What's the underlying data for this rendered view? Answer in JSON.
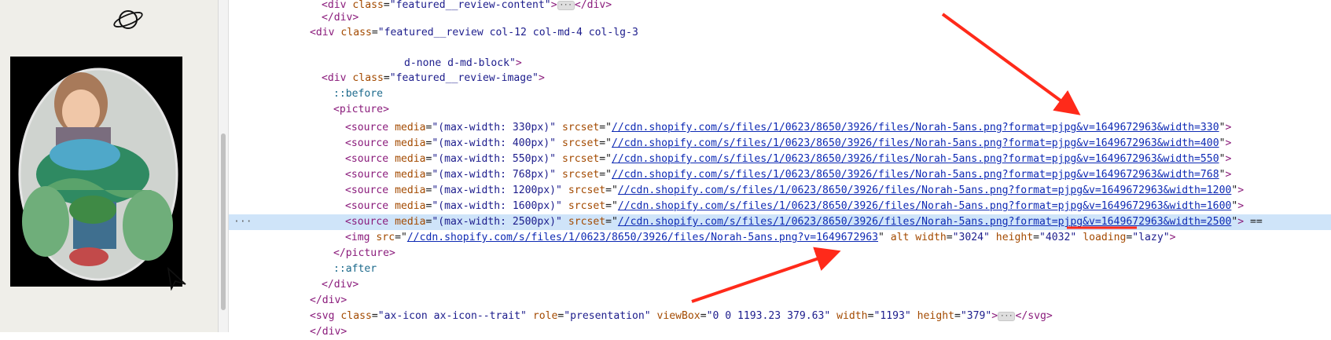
{
  "sidebar": {
    "planet_icon": "planet-icon",
    "photo_alt": "child holding chameleon artwork"
  },
  "gutter": {
    "selected_marker": "···",
    "selected_suffix": " =="
  },
  "lines": [
    {
      "indent": 1,
      "tri": "▶",
      "text_parts": [
        [
          "tag",
          "<div "
        ],
        [
          "attr",
          "class"
        ],
        [
          "",
          "="
        ],
        [
          "val",
          "\"featured__review-content\""
        ],
        [
          "tag",
          ">"
        ]
      ],
      "dots": true,
      "after": [
        [
          "tag",
          "</div>"
        ]
      ]
    },
    {
      "indent": 1,
      "tri": "",
      "text_parts": [
        [
          "tag",
          "</div>"
        ]
      ]
    },
    {
      "indent": 0,
      "tri": "▼",
      "text_parts": [
        [
          "tag",
          "<div "
        ],
        [
          "attr",
          "class"
        ],
        [
          "",
          "="
        ],
        [
          "val",
          "\"featured__review col-12 col-md-4 col-lg-3"
        ]
      ]
    },
    {
      "indent": 0,
      "tri": "",
      "text_parts": [
        [
          "",
          ""
        ]
      ]
    },
    {
      "indent": 8,
      "tri": "",
      "text_parts": [
        [
          "val",
          "d-none d-md-block\""
        ],
        [
          "tag",
          ">"
        ]
      ]
    },
    {
      "indent": 1,
      "tri": "▼",
      "text_parts": [
        [
          "tag",
          "<div "
        ],
        [
          "attr",
          "class"
        ],
        [
          "",
          "="
        ],
        [
          "val",
          "\"featured__review-image\""
        ],
        [
          "tag",
          ">"
        ]
      ]
    },
    {
      "indent": 2,
      "tri": "",
      "text_parts": [
        [
          "pseudo",
          "::before"
        ]
      ]
    },
    {
      "indent": 2,
      "tri": "▼",
      "text_parts": [
        [
          "tag",
          "<picture>"
        ]
      ]
    },
    {
      "indent": 3,
      "tri": "",
      "text_parts": [
        [
          "tag",
          "<source "
        ],
        [
          "attr",
          "media"
        ],
        [
          "",
          "="
        ],
        [
          "val",
          "\"(max-width: 330px)\""
        ],
        [
          "attr",
          " srcset"
        ],
        [
          "",
          "=\""
        ],
        [
          "url",
          "//cdn.shopify.com/s/files/1/0623/8650/3926/files/Norah-5ans.png?format=pjpg&v=1649672963&width=330"
        ],
        [
          "",
          "\""
        ],
        [
          "tag",
          ">"
        ]
      ]
    },
    {
      "indent": 3,
      "tri": "",
      "text_parts": [
        [
          "tag",
          "<source "
        ],
        [
          "attr",
          "media"
        ],
        [
          "",
          "="
        ],
        [
          "val",
          "\"(max-width: 400px)\""
        ],
        [
          "attr",
          " srcset"
        ],
        [
          "",
          "=\""
        ],
        [
          "url",
          "//cdn.shopify.com/s/files/1/0623/8650/3926/files/Norah-5ans.png?format=pjpg&v=1649672963&width=400"
        ],
        [
          "",
          "\""
        ],
        [
          "tag",
          ">"
        ]
      ]
    },
    {
      "indent": 3,
      "tri": "",
      "text_parts": [
        [
          "tag",
          "<source "
        ],
        [
          "attr",
          "media"
        ],
        [
          "",
          "="
        ],
        [
          "val",
          "\"(max-width: 550px)\""
        ],
        [
          "attr",
          " srcset"
        ],
        [
          "",
          "=\""
        ],
        [
          "url",
          "//cdn.shopify.com/s/files/1/0623/8650/3926/files/Norah-5ans.png?format=pjpg&v=1649672963&width=550"
        ],
        [
          "",
          "\""
        ],
        [
          "tag",
          ">"
        ]
      ]
    },
    {
      "indent": 3,
      "tri": "",
      "text_parts": [
        [
          "tag",
          "<source "
        ],
        [
          "attr",
          "media"
        ],
        [
          "",
          "="
        ],
        [
          "val",
          "\"(max-width: 768px)\""
        ],
        [
          "attr",
          " srcset"
        ],
        [
          "",
          "=\""
        ],
        [
          "url",
          "//cdn.shopify.com/s/files/1/0623/8650/3926/files/Norah-5ans.png?format=pjpg&v=1649672963&width=768"
        ],
        [
          "",
          "\""
        ],
        [
          "tag",
          ">"
        ]
      ]
    },
    {
      "indent": 3,
      "tri": "",
      "text_parts": [
        [
          "tag",
          "<source "
        ],
        [
          "attr",
          "media"
        ],
        [
          "",
          "="
        ],
        [
          "val",
          "\"(max-width: 1200px)\""
        ],
        [
          "attr",
          " srcset"
        ],
        [
          "",
          "=\""
        ],
        [
          "url",
          "//cdn.shopify.com/s/files/1/0623/8650/3926/files/Norah-5ans.png?format=pjpg&v=1649672963&width=1200"
        ],
        [
          "",
          "\""
        ],
        [
          "tag",
          ">"
        ]
      ]
    },
    {
      "indent": 3,
      "tri": "",
      "text_parts": [
        [
          "tag",
          "<source "
        ],
        [
          "attr",
          "media"
        ],
        [
          "",
          "="
        ],
        [
          "val",
          "\"(max-width: 1600px)\""
        ],
        [
          "attr",
          " srcset"
        ],
        [
          "",
          "=\""
        ],
        [
          "url",
          "//cdn.shopify.com/s/files/1/0623/8650/3926/files/Norah-5ans.png?format=pjpg&v=1649672963&width=1600"
        ],
        [
          "",
          "\""
        ],
        [
          "tag",
          ">"
        ]
      ]
    },
    {
      "indent": 3,
      "tri": "",
      "selected": true,
      "text_parts": [
        [
          "tag",
          "<source "
        ],
        [
          "attr",
          "media"
        ],
        [
          "",
          "="
        ],
        [
          "val",
          "\"(max-width: 2500px)\""
        ],
        [
          "attr",
          " srcset"
        ],
        [
          "",
          "=\""
        ],
        [
          "url",
          "//cdn.shopify.com/s/files/1/0623/8650/3926/files/Norah-5ans.png?format=pjpg&v=1649672963&width=2500"
        ],
        [
          "",
          "\""
        ],
        [
          "tag",
          ">"
        ]
      ]
    },
    {
      "indent": 3,
      "tri": "",
      "text_parts": [
        [
          "tag",
          "<img "
        ],
        [
          "attr",
          "src"
        ],
        [
          "",
          "=\""
        ],
        [
          "url",
          "//cdn.shopify.com/s/files/1/0623/8650/3926/files/Norah-5ans.png?v=1649672963"
        ],
        [
          "",
          "\""
        ],
        [
          "attr",
          " alt width"
        ],
        [
          "",
          "="
        ],
        [
          "val",
          "\"3024\""
        ],
        [
          "attr",
          " height"
        ],
        [
          "",
          "="
        ],
        [
          "val",
          "\"4032\""
        ],
        [
          "attr",
          " loading"
        ],
        [
          "",
          "="
        ],
        [
          "val",
          "\"lazy\""
        ],
        [
          "tag",
          ">"
        ]
      ]
    },
    {
      "indent": 2,
      "tri": "",
      "text_parts": [
        [
          "tag",
          "</picture>"
        ]
      ]
    },
    {
      "indent": 2,
      "tri": "",
      "text_parts": [
        [
          "pseudo",
          "::after"
        ]
      ]
    },
    {
      "indent": 1,
      "tri": "",
      "text_parts": [
        [
          "tag",
          "</div>"
        ]
      ]
    },
    {
      "indent": 0,
      "tri": "",
      "text_parts": [
        [
          "tag",
          "</div>"
        ]
      ]
    },
    {
      "indent": 0,
      "tri": "▶",
      "text_parts": [
        [
          "tag",
          "<svg "
        ],
        [
          "attr",
          "class"
        ],
        [
          "",
          "="
        ],
        [
          "val",
          "\"ax-icon ax-icon--trait\""
        ],
        [
          "attr",
          " role"
        ],
        [
          "",
          "="
        ],
        [
          "val",
          "\"presentation\""
        ],
        [
          "attr",
          " viewBox"
        ],
        [
          "",
          "="
        ],
        [
          "val",
          "\"0 0 1193.23 379.63\""
        ],
        [
          "attr",
          " width"
        ],
        [
          "",
          "="
        ],
        [
          "val",
          "\"1193\""
        ],
        [
          "attr",
          " height"
        ],
        [
          "",
          "="
        ],
        [
          "val",
          "\"379\""
        ],
        [
          "tag",
          ">"
        ]
      ],
      "dots": true,
      "after": [
        [
          "tag",
          "</svg>"
        ]
      ]
    },
    {
      "indent": 0,
      "tri": "",
      "text_parts": [
        [
          "tag",
          "</div>"
        ]
      ]
    }
  ],
  "colors": {
    "arrow": "#ff2a1a",
    "selection": "#cfe4f9"
  }
}
